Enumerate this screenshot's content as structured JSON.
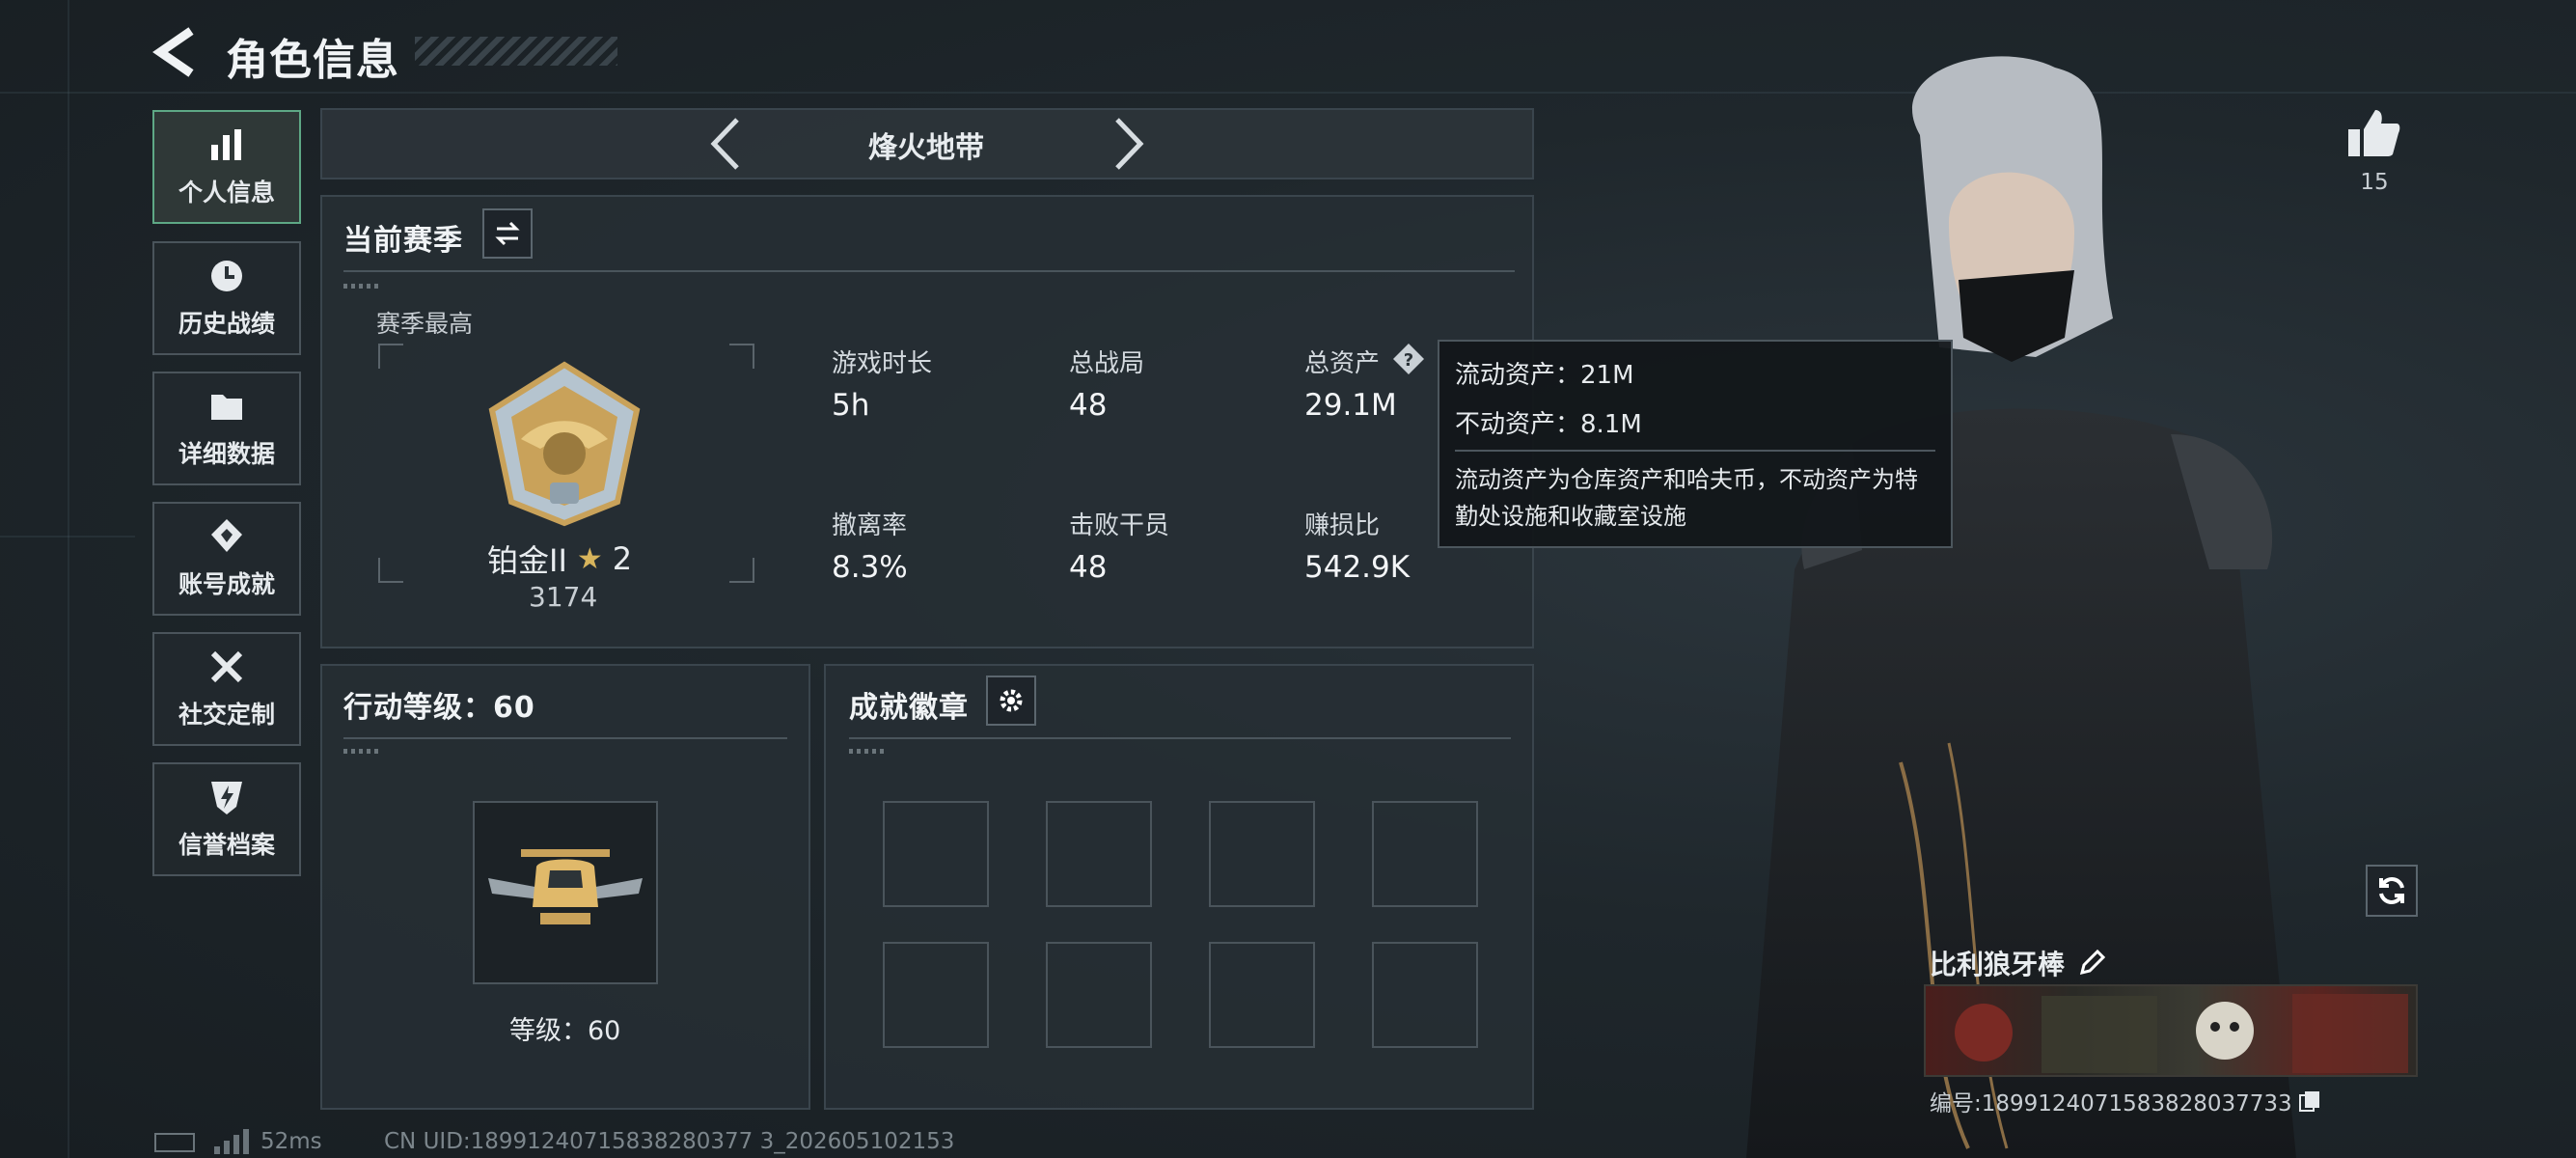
{
  "header": {
    "title": "角色信息"
  },
  "sidebar": {
    "items": [
      {
        "label": "个人信息",
        "icon": "bar-chart-icon",
        "active": true
      },
      {
        "label": "历史战绩",
        "icon": "clock-icon",
        "active": false
      },
      {
        "label": "详细数据",
        "icon": "folder-icon",
        "active": false
      },
      {
        "label": "账号成就",
        "icon": "medal-icon",
        "active": false
      },
      {
        "label": "社交定制",
        "icon": "tools-icon",
        "active": false
      },
      {
        "label": "信誉档案",
        "icon": "shield-bolt-icon",
        "active": false
      }
    ]
  },
  "mode_selector": {
    "label": "烽火地带"
  },
  "season": {
    "title": "当前赛季",
    "best_label": "赛季最高",
    "rank_name": "铂金II",
    "rank_stars": "2",
    "rank_score": "3174",
    "stats": [
      {
        "label": "游戏时长",
        "value": "5h"
      },
      {
        "label": "总战局",
        "value": "48"
      },
      {
        "label": "总资产",
        "value": "29.1M"
      },
      {
        "label": "撤离率",
        "value": "8.3%"
      },
      {
        "label": "击败干员",
        "value": "48"
      },
      {
        "label": "赚损比",
        "value": "542.9K"
      }
    ]
  },
  "tooltip": {
    "liquid": "流动资产：21M",
    "fixed": "不动资产：8.1M",
    "desc": "流动资产为仓库资产和哈夫币，不动资产为特勤处设施和收藏室设施"
  },
  "action_level": {
    "title": "行动等级：60",
    "level_label": "等级：60"
  },
  "achievements": {
    "title": "成就徽章"
  },
  "likes": {
    "count": "15"
  },
  "player": {
    "name": "比利狼牙棒",
    "id_text": "编号:1899124071583828037733"
  },
  "footer": {
    "ping": "52ms",
    "uid": "CN UID:18991240715838280377 3_202605102153"
  },
  "colors": {
    "accent": "#5ea885",
    "gold": "#c9a25a",
    "panel": "#262e34"
  }
}
